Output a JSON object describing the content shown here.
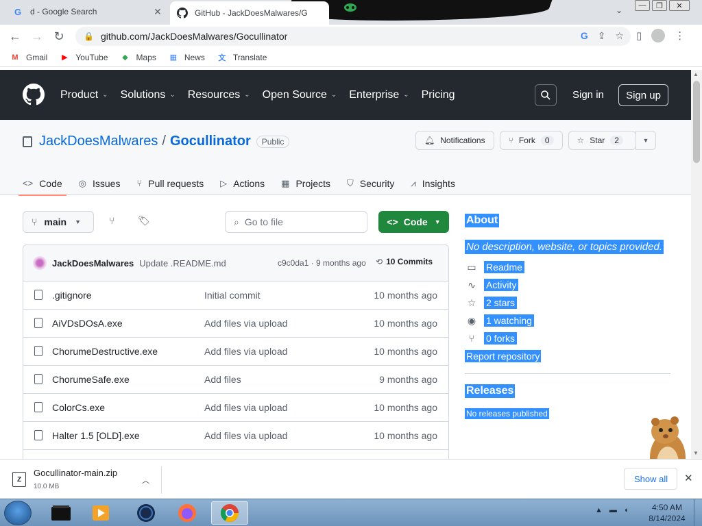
{
  "browser": {
    "tabs": [
      {
        "title": "d - Google Search",
        "favicon": "G"
      },
      {
        "title": "GitHub - JackDoesMalwares/G",
        "favicon": "github-icon"
      }
    ],
    "url": "github.com/JackDoesMalwares/Gocullinator",
    "bookmarks": [
      {
        "label": "Gmail",
        "icon": "M",
        "color": "#ea4335"
      },
      {
        "label": "YouTube",
        "icon": "▶",
        "color": "#ff0000"
      },
      {
        "label": "Maps",
        "icon": "◆",
        "color": "#34a853"
      },
      {
        "label": "News",
        "icon": "▦",
        "color": "#4285f4"
      },
      {
        "label": "Translate",
        "icon": "文",
        "color": "#4285f4"
      }
    ]
  },
  "github": {
    "nav": [
      {
        "label": "Product",
        "dropdown": true
      },
      {
        "label": "Solutions",
        "dropdown": true
      },
      {
        "label": "Resources",
        "dropdown": true
      },
      {
        "label": "Open Source",
        "dropdown": true
      },
      {
        "label": "Enterprise",
        "dropdown": true
      },
      {
        "label": "Pricing",
        "dropdown": false
      }
    ],
    "sign_in": "Sign in",
    "sign_up": "Sign up"
  },
  "repo": {
    "owner": "JackDoesMalwares",
    "name": "Gocullinator",
    "visibility": "Public",
    "notifications_label": "Notifications",
    "fork_label": "Fork",
    "fork_count": "0",
    "star_label": "Star",
    "star_count": "2",
    "tabs": [
      {
        "label": "Code",
        "icon": "<>"
      },
      {
        "label": "Issues",
        "icon": "◎"
      },
      {
        "label": "Pull requests",
        "icon": "⑂"
      },
      {
        "label": "Actions",
        "icon": "▷"
      },
      {
        "label": "Projects",
        "icon": "▦"
      },
      {
        "label": "Security",
        "icon": "⛉"
      },
      {
        "label": "Insights",
        "icon": "⩘"
      }
    ],
    "branch": "main",
    "go_to_file": "Go to file",
    "code_button": "Code",
    "last_commit": {
      "author": "JackDoesMalwares",
      "message": "Update .README.md",
      "meta": "c9c0da1 · 9 months ago",
      "commits": "10 Commits"
    },
    "files": [
      {
        "name": ".gitignore",
        "message": "Initial commit",
        "date": "10 months ago"
      },
      {
        "name": "AiVDsDOsA.exe",
        "message": "Add files via upload",
        "date": "10 months ago"
      },
      {
        "name": "ChorumeDestructive.exe",
        "message": "Add files via upload",
        "date": "10 months ago"
      },
      {
        "name": "ChorumeSafe.exe",
        "message": "Add files",
        "date": "9 months ago"
      },
      {
        "name": "ColorCs.exe",
        "message": "Add files via upload",
        "date": "10 months ago"
      },
      {
        "name": "Halter 1.5 [OLD].exe",
        "message": "Add files via upload",
        "date": "10 months ago"
      }
    ],
    "about": {
      "title": "About",
      "description": "No description, website, or topics provided.",
      "items": [
        {
          "label": "Readme",
          "icon": "book-icon",
          "glyph": "📖"
        },
        {
          "label": "Activity",
          "icon": "pulse-icon",
          "glyph": "∿"
        },
        {
          "label": "2 stars",
          "icon": "star-icon",
          "glyph": "☆"
        },
        {
          "label": "1 watching",
          "icon": "eye-icon",
          "glyph": "◉"
        },
        {
          "label": "0 forks",
          "icon": "fork-icon",
          "glyph": "⑂"
        }
      ],
      "report": "Report repository",
      "releases_title": "Releases",
      "releases_none": "No releases published"
    }
  },
  "download": {
    "filename": "Gocullinator-main.zip",
    "size": "10.0 MB",
    "show_all": "Show all"
  },
  "taskbar": {
    "time": "4:50 AM",
    "date": "8/14/2024"
  },
  "colors": {
    "highlight": "#3390ff",
    "gh_header": "#24292f",
    "code_green": "#1f883d",
    "link_blue": "#0969da"
  }
}
